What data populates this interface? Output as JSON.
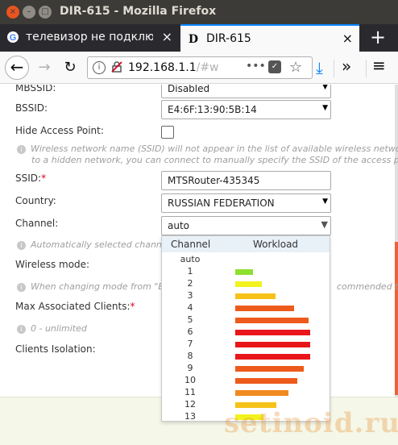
{
  "window": {
    "title": "DIR-615 - Mozilla Firefox",
    "controls": [
      "×",
      "–",
      "□"
    ]
  },
  "tabs": [
    {
      "label": "телевизор не подключа",
      "close": "×",
      "favicon": "G"
    },
    {
      "label": "DIR-615",
      "close": "×",
      "favicon": "D"
    }
  ],
  "new_tab": "+",
  "toolbar": {
    "back": "←",
    "forward": "→",
    "reload": "↻",
    "url_host": "192.168.1.1",
    "url_path": "/#w",
    "page_actions": "•••",
    "star": "☆",
    "download": "⤓",
    "overflow": "»",
    "menu": "≡"
  },
  "form": {
    "mbssid_label": "MBSSID:",
    "mbssid_value": "Disabled",
    "bssid_label": "BSSID:",
    "bssid_value": "E4:6F:13:90:5B:14",
    "hide_ap_label": "Hide Access Point:",
    "hide_ap_hint_1": "Wireless network name (SSID) will not appear in the list of available wireless netwo",
    "hide_ap_hint_2": "to a hidden network, you can connect to manually specify the SSID of the access po",
    "ssid_label": "SSID:",
    "ssid_required": "*",
    "ssid_value": "MTSRouter-435345",
    "country_label": "Country:",
    "country_value": "RUSSIAN FEDERATION",
    "channel_label": "Channel:",
    "channel_value": "auto",
    "channel_hint": "Automatically selected channe",
    "wireless_mode_label": "Wireless mode:",
    "wireless_mode_hint_left": "When changing mode from \"E",
    "wireless_mode_hint_right": "commended t",
    "max_clients_label": "Max Associated Clients:",
    "max_clients_required": "*",
    "max_clients_hint": "0 - unlimited",
    "isolation_label": "Clients Isolation:"
  },
  "channel_dropdown": {
    "col_channel": "Channel",
    "col_workload": "Workload",
    "rows": [
      {
        "channel": "auto",
        "workload": null,
        "color": ""
      },
      {
        "channel": "1",
        "workload": 0.24,
        "color": "#8ee02e"
      },
      {
        "channel": "2",
        "workload": 0.36,
        "color": "#f2f21e"
      },
      {
        "channel": "3",
        "workload": 0.54,
        "color": "#f6c21a"
      },
      {
        "channel": "4",
        "workload": 0.79,
        "color": "#ee5a1c"
      },
      {
        "channel": "5",
        "workload": 0.98,
        "color": "#ee5a1c"
      },
      {
        "channel": "6",
        "workload": 1.0,
        "color": "#e8161a"
      },
      {
        "channel": "7",
        "workload": 1.0,
        "color": "#e8161a"
      },
      {
        "channel": "8",
        "workload": 1.0,
        "color": "#e8161a"
      },
      {
        "channel": "9",
        "workload": 0.91,
        "color": "#ee5a1c"
      },
      {
        "channel": "10",
        "workload": 0.83,
        "color": "#ee5a1c"
      },
      {
        "channel": "11",
        "workload": 0.71,
        "color": "#f08a1e"
      },
      {
        "channel": "12",
        "workload": 0.55,
        "color": "#f6c21a"
      },
      {
        "channel": "13",
        "workload": 0.38,
        "color": "#f2f21e"
      }
    ]
  },
  "watermark": "setinoid.ru"
}
